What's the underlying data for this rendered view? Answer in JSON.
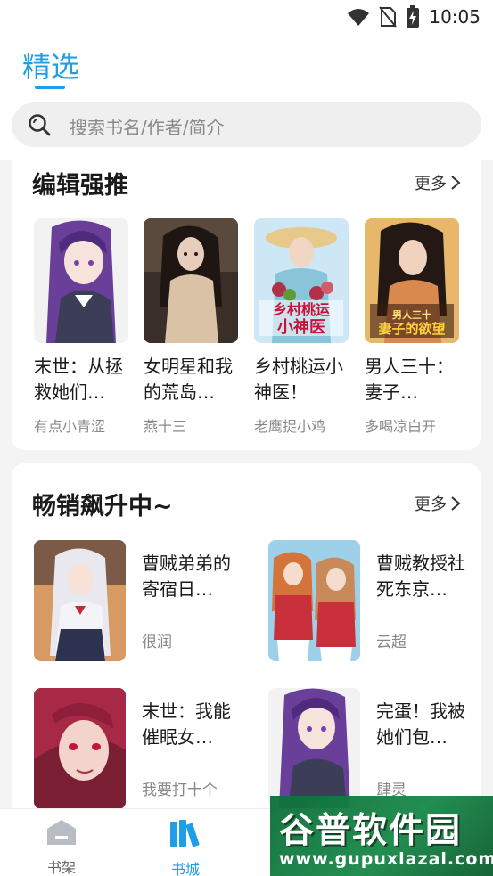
{
  "status_bar": {
    "time": "10:05",
    "icons": [
      "wifi-icon",
      "no-sim-icon",
      "battery-charging-icon"
    ]
  },
  "header": {
    "title": "精选",
    "search_placeholder": "搜索书名/作者/简介"
  },
  "editor_picks": {
    "title": "编辑强推",
    "more_label": "更多",
    "books": [
      {
        "title": "末世：从拯救她们…",
        "author": "有点小青涩"
      },
      {
        "title": "女明星和我的荒岛…",
        "author": "燕十三"
      },
      {
        "title": "乡村桃运小神医！",
        "author": "老鹰捉小鸡",
        "cover_text": "乡村桃运小神医"
      },
      {
        "title": "男人三十：妻子…",
        "author": "多喝凉白开",
        "cover_text": "男人三十 妻子的欲望"
      }
    ]
  },
  "bestsellers": {
    "title": "畅销飙升中~",
    "more_label": "更多",
    "books": [
      {
        "title": "曹贼弟弟的寄宿日…",
        "author": "很润"
      },
      {
        "title": "曹贼教授社死东京…",
        "author": "云超"
      },
      {
        "title": "末世：我能催眠女…",
        "author": "我要打十个"
      },
      {
        "title": "完蛋！我被她们包…",
        "author": "肆灵"
      }
    ]
  },
  "bottom_nav": {
    "items": [
      {
        "label": "书架"
      },
      {
        "label": "书城"
      }
    ],
    "active_index": 1
  },
  "watermark": {
    "main": "谷普软件园",
    "sub": "www.gupuxlazal.com"
  },
  "colors": {
    "accent": "#1f9ee8",
    "background": "#f4f4f4"
  }
}
